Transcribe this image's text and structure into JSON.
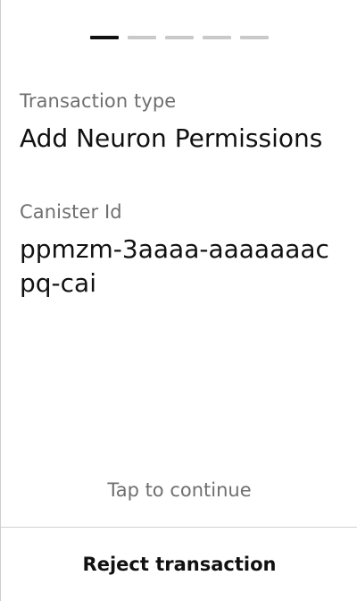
{
  "progress": {
    "total_steps": 5,
    "current_step": 1
  },
  "transaction_type": {
    "label": "Transaction type",
    "value": "Add Neuron Permissions"
  },
  "canister_id": {
    "label": "Canister Id",
    "value": "ppmzm-3aaaa-aaaaaaacpq-cai"
  },
  "hint": {
    "tap_to_continue": "Tap to continue"
  },
  "actions": {
    "reject_label": "Reject transaction"
  },
  "colors": {
    "active_step": "#111111",
    "inactive_step": "#c9c9c9",
    "label_text": "#6f6f6f",
    "value_text": "#111111",
    "divider": "#d2d2d2"
  }
}
